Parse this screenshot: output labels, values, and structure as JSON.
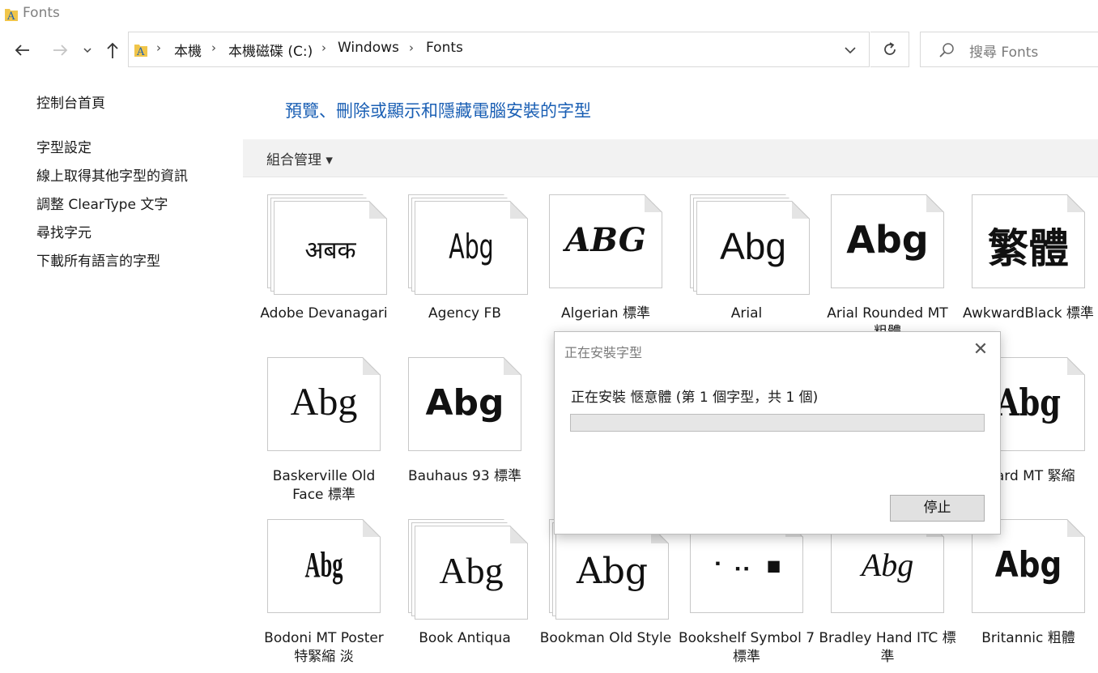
{
  "window": {
    "title": "Fonts"
  },
  "address": {
    "crumbs": [
      "本機",
      "本機磁碟 (C:)",
      "Windows",
      "Fonts"
    ],
    "separator": "›"
  },
  "search": {
    "placeholder": "搜尋 Fonts"
  },
  "left_pane": {
    "links": [
      "控制台首頁",
      "字型設定",
      "線上取得其他字型的資訊",
      "調整 ClearType 文字",
      "尋找字元",
      "下載所有語言的字型"
    ]
  },
  "main": {
    "heading": "預覽、刪除或顯示和隱藏電腦安裝的字型",
    "organize_label": "組合管理 ▾"
  },
  "fonts": [
    {
      "name": "Adobe Devanagari",
      "sample": "अबक",
      "stacked": true
    },
    {
      "name": "Agency FB",
      "sample": "Abg",
      "stacked": true
    },
    {
      "name": "Algerian 標準",
      "sample": "ABG",
      "stacked": false
    },
    {
      "name": "Arial",
      "sample": "Abg",
      "stacked": true
    },
    {
      "name": "Arial Rounded MT 粗體",
      "sample": "Abg",
      "stacked": false
    },
    {
      "name": "AwkwardBlack 標準",
      "sample": "繁體",
      "stacked": false
    },
    {
      "name": "Baskerville Old Face 標準",
      "sample": "Abg",
      "stacked": false
    },
    {
      "name": "Bauhaus 93 標準",
      "sample": "Abg",
      "stacked": false
    },
    {
      "name": "rnard MT 緊縮",
      "sample": "Abg",
      "stacked": false
    },
    {
      "name": "Bodoni MT Poster 特緊縮 淡",
      "sample": "Abg",
      "stacked": false
    },
    {
      "name": "Book Antiqua",
      "sample": "Abg",
      "stacked": true
    },
    {
      "name": "Bookman Old Style",
      "sample": "Abg",
      "stacked": true
    },
    {
      "name": "Bookshelf Symbol 7 標準",
      "sample": "⠂⠠⠄ ■",
      "stacked": false
    },
    {
      "name": "Bradley Hand ITC 標準",
      "sample": "Abg",
      "stacked": false
    },
    {
      "name": "Britannic 粗體",
      "sample": "Abg",
      "stacked": false
    }
  ],
  "dialog": {
    "title": "正在安裝字型",
    "status": "正在安裝 愜意體 (第 1 個字型，共 1 個)",
    "progress": 0,
    "stop_label": "停止",
    "close_glyph": "✕"
  },
  "icons": {
    "back": "back-arrow-icon",
    "forward": "forward-arrow-icon",
    "recent": "chevron-down-icon",
    "up": "up-arrow-icon",
    "refresh": "refresh-icon",
    "search": "search-icon",
    "folder": "fonts-folder-icon"
  }
}
